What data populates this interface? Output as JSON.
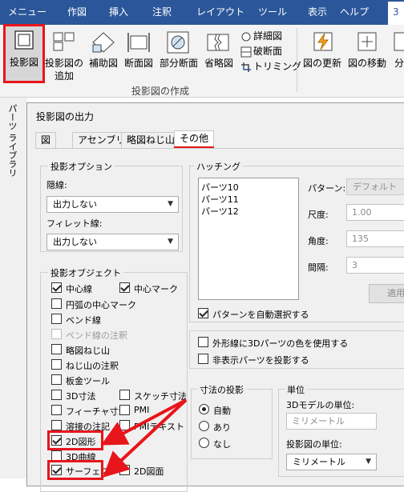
{
  "menu": {
    "items": [
      "メニュー",
      "作図",
      "挿入",
      "注釈",
      "レイアウト",
      "ツール",
      "表示",
      "ヘルプ"
    ],
    "active_item": "3"
  },
  "ribbon": {
    "project_view_label": "投影図",
    "projected_add_label_1": "投影図の",
    "projected_add_label_2": "追加",
    "auxiliary_label": "補助図",
    "section_label": "断面図",
    "partial_section_label": "部分断面",
    "broken_label": "省略図",
    "detail_label": "詳細図",
    "break_section_label": "破断面",
    "trimming_label": "トリミング",
    "update_label": "図の更新",
    "move_label": "図の移動",
    "partial_label": "分",
    "group_label": "投影図の作成"
  },
  "side_panel": {
    "label": "パーツ ライブラリ"
  },
  "dialog": {
    "title": "投影図の出力",
    "tabs": [
      "図",
      "アセンブリ",
      "略図ねじ山",
      "その他"
    ],
    "projection_options": {
      "title": "投影オプション",
      "hidden_label": "隠線:",
      "hidden_value": "出力しない",
      "fillet_label": "フィレット線:",
      "fillet_value": "出力しない"
    },
    "hatching": {
      "title": "ハッチング",
      "parts": [
        "パーツ10",
        "パーツ11",
        "パーツ12"
      ],
      "pattern_label": "パターン:",
      "pattern_value": "デフォルト",
      "scale_label": "尺度:",
      "scale_value": "1.00",
      "angle_label": "角度:",
      "angle_value": "135",
      "spacing_label": "間隔:",
      "spacing_value": "3",
      "apply_label": "適用",
      "auto_select_label": "パターンを自動選択する"
    },
    "outline": {
      "use_3d_colors_label": "外形線に3Dパーツの色を使用する",
      "project_hidden_label": "非表示パーツを投影する"
    },
    "projection_objects": {
      "title": "投影オブジェクト",
      "center_line": "中心線",
      "center_mark": "中心マーク",
      "arc_center_mark": "円弧の中心マーク",
      "bend_line": "ベンド線",
      "bend_line_note": "ベンド線の注釈",
      "cosmetic_thread": "略図ねじ山",
      "thread_note": "ねじ山の注釈",
      "sheet_metal_tool": "板金ツール",
      "dim_3d": "3D寸法",
      "sketch_dim": "スケッチ寸法",
      "fillet_weld": "フィーチャ寸法",
      "pmi": "PMI",
      "weld_note": "溶接の注記",
      "pmi_text": "PMIテキスト",
      "shape_2d": "2D図形",
      "curve_3d": "3D曲線",
      "surface": "サーフェス",
      "drawing_2d": "2D図面"
    },
    "dim_projection": {
      "title": "寸法の投影",
      "auto": "自動",
      "yes": "あり",
      "no": "なし"
    },
    "units": {
      "title": "単位",
      "model_units_label": "3Dモデルの単位:",
      "model_units_value": "ミリメートル",
      "view_units_label": "投影図の単位:",
      "view_units_value": "ミリメートル"
    }
  },
  "colors": {
    "ribbon_blue": "#2b579a",
    "highlight_red": "#e8151b"
  }
}
